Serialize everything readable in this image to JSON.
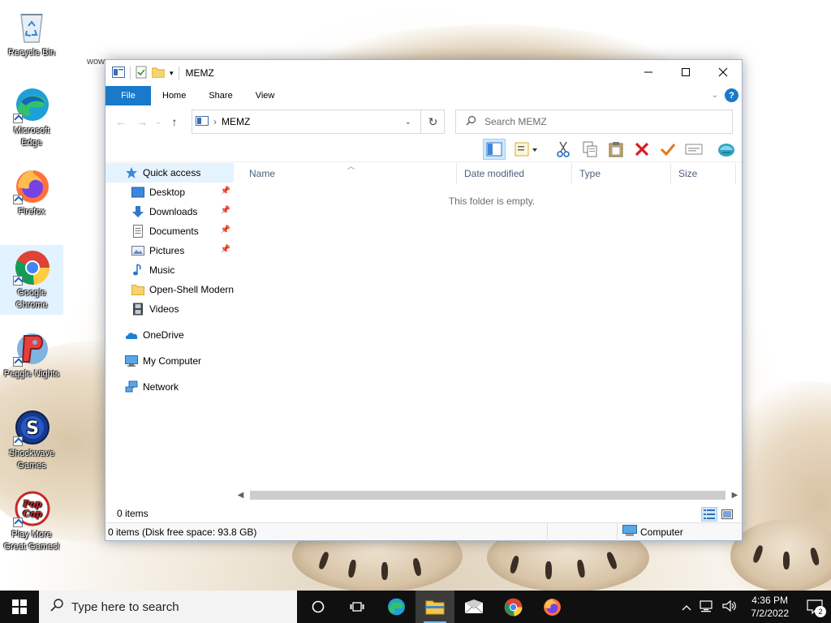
{
  "desktop": {
    "behind_window_text": "wow",
    "icons": [
      {
        "label": "Recycle Bin"
      },
      {
        "label": "Microsoft Edge"
      },
      {
        "label": "Firefox"
      },
      {
        "label": "Google Chrome"
      },
      {
        "label": "Peggle Nights"
      },
      {
        "label": "Shockwave Games"
      },
      {
        "label": "Play More Great Games!"
      }
    ]
  },
  "window": {
    "title": "MEMZ",
    "ribbon_tabs": [
      "File",
      "Home",
      "Share",
      "View"
    ],
    "address": {
      "path": "MEMZ"
    },
    "search": {
      "placeholder": "Search MEMZ"
    },
    "nav": {
      "quick_access": "Quick access",
      "pinned": [
        "Desktop",
        "Downloads",
        "Documents",
        "Pictures"
      ],
      "unpinned": [
        "Music",
        "Open-Shell Modern",
        "Videos"
      ],
      "onedrive": "OneDrive",
      "my_computer": "My Computer",
      "network": "Network"
    },
    "columns": [
      "Name",
      "Date modified",
      "Type",
      "Size"
    ],
    "empty_message": "This folder is empty.",
    "item_count": "0 items",
    "status": {
      "left": "0 items (Disk free space: 93.8 GB)",
      "right": "Computer"
    }
  },
  "taskbar": {
    "search_placeholder": "Type here to search",
    "time": "4:36 PM",
    "date": "7/2/2022",
    "notification_count": "2"
  },
  "colors": {
    "ribbon_file_tab": "#1979ca",
    "taskbar": "#101010",
    "selection": "#cce8ff",
    "quick_access_highlight": "#e5f3ff"
  }
}
